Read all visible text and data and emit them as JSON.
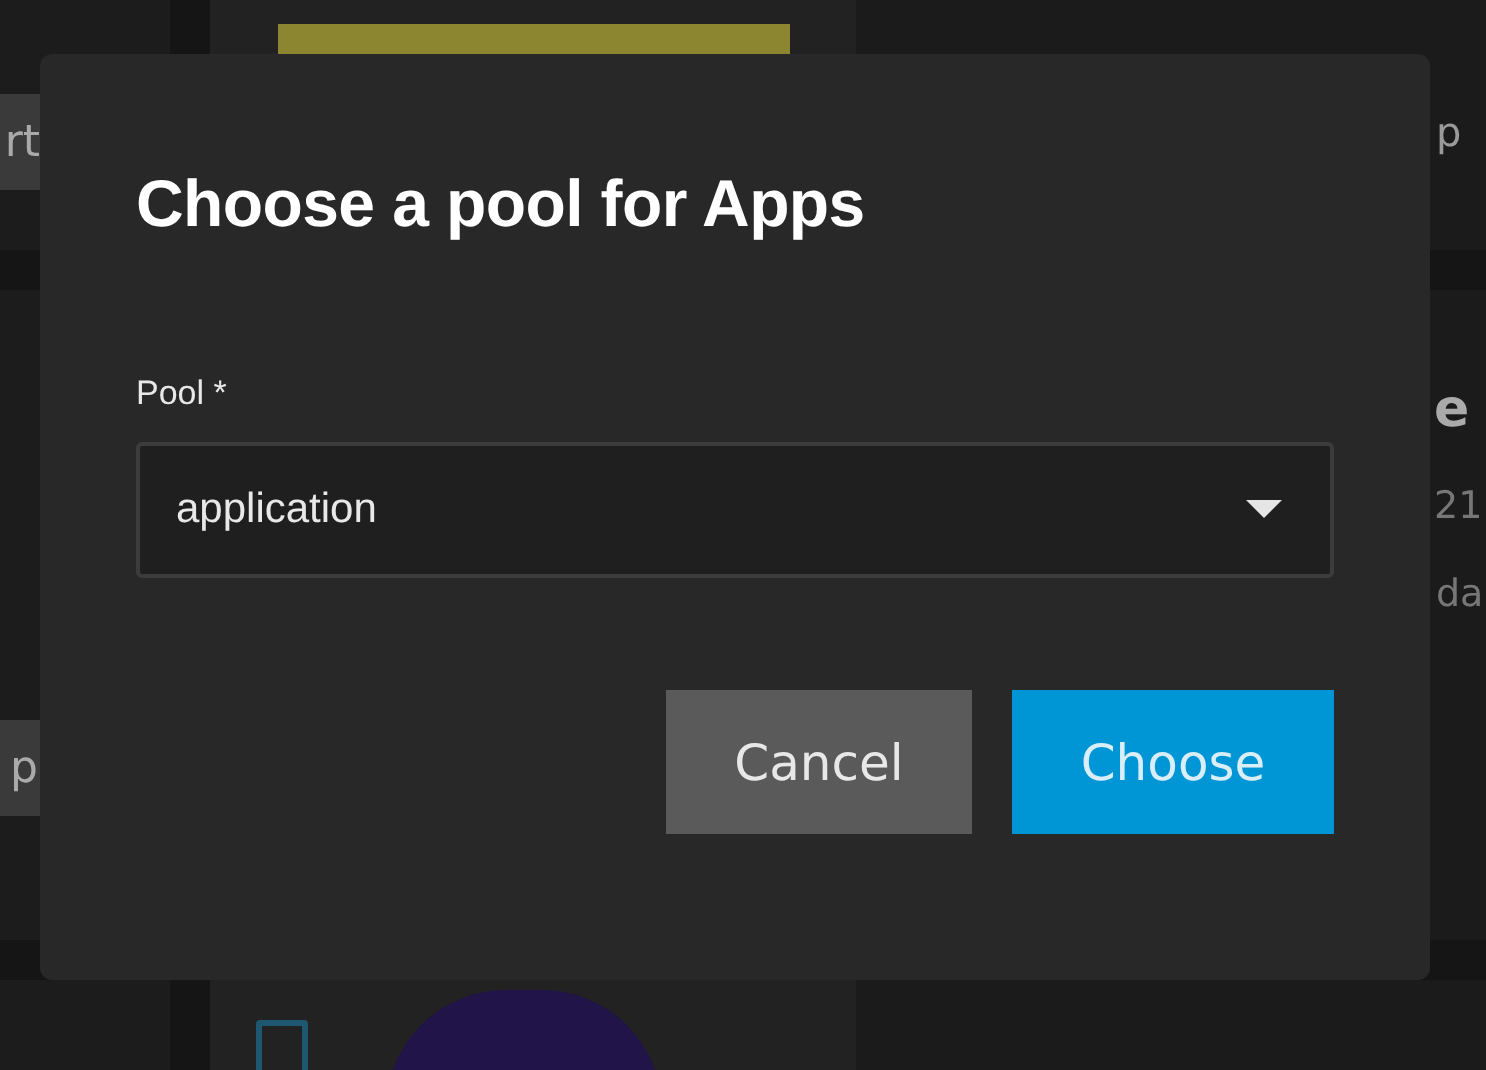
{
  "background": {
    "left_buttons": [
      "rt",
      "p"
    ],
    "right_texts": [
      {
        "kind": "plain",
        "text": "p"
      },
      {
        "kind": "heading",
        "text": "e"
      },
      {
        "kind": "muted",
        "text": "21"
      },
      {
        "kind": "muted",
        "text": "da"
      }
    ]
  },
  "dialog": {
    "title": "Choose a pool for Apps",
    "field": {
      "label": "Pool *",
      "value": "application"
    },
    "buttons": [
      {
        "label": "Cancel",
        "kind": "secondary"
      },
      {
        "label": "Choose",
        "kind": "primary"
      }
    ]
  }
}
